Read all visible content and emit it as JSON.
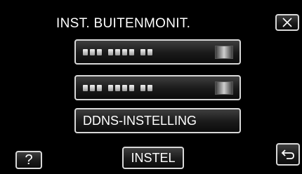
{
  "header": {
    "title": "INST. BUITENMONIT."
  },
  "items": [
    {
      "label": ""
    },
    {
      "label": ""
    },
    {
      "label": "DDNS-INSTELLING"
    }
  ],
  "footer": {
    "help_label": "?",
    "set_label": "INSTEL"
  },
  "icons": {
    "close": "close-icon",
    "back": "back-arrow-icon"
  }
}
